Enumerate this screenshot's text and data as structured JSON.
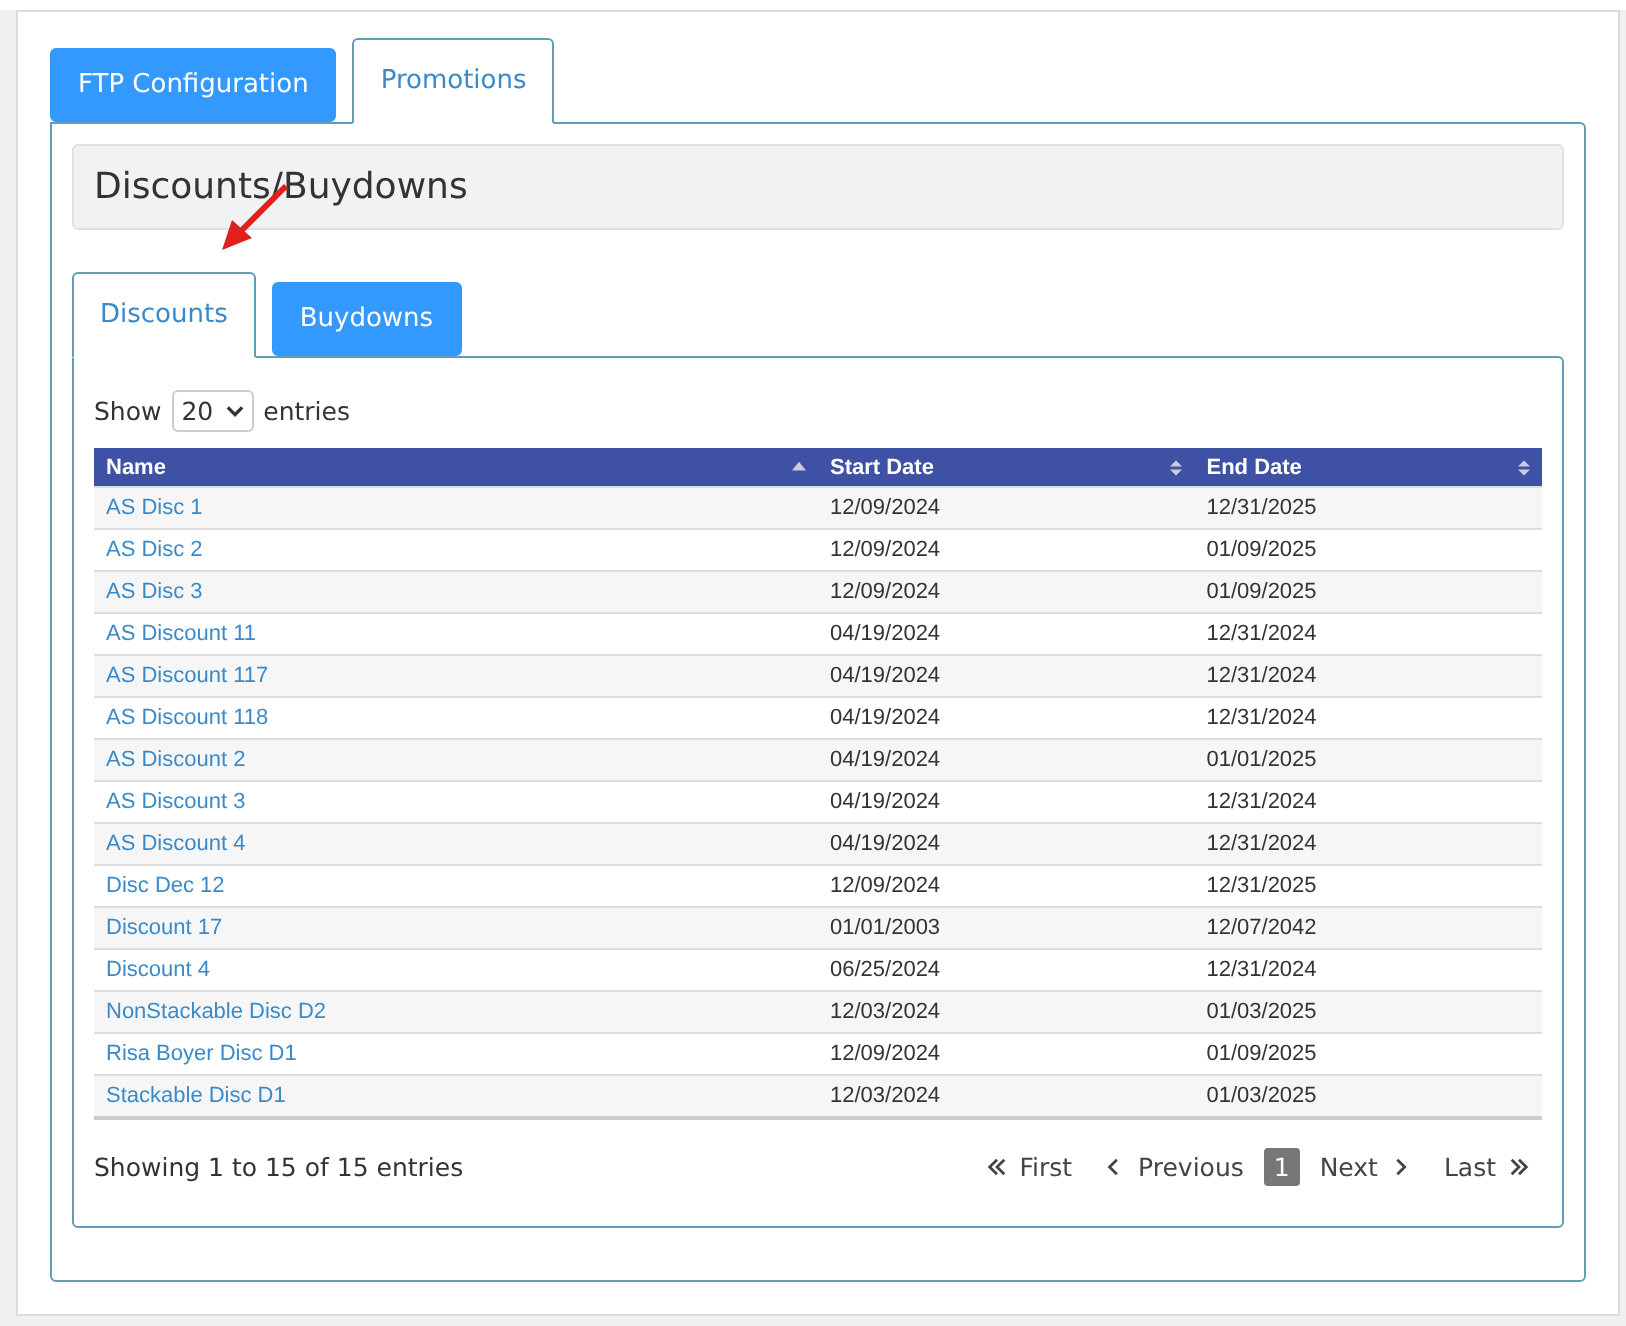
{
  "tabs": [
    {
      "label": "FTP Configuration",
      "selected": false
    },
    {
      "label": "Promotions",
      "selected": true
    }
  ],
  "section_title": "Discounts/Buydowns",
  "subtabs": [
    {
      "label": "Discounts",
      "selected": true
    },
    {
      "label": "Buydowns",
      "selected": false
    }
  ],
  "length_menu": {
    "before": "Show",
    "value": "20",
    "after": "entries"
  },
  "table": {
    "columns": [
      {
        "label": "Name",
        "sorted": true
      },
      {
        "label": "Start Date",
        "sorted": false
      },
      {
        "label": "End Date",
        "sorted": false
      }
    ],
    "rows": [
      [
        "AS Disc 1",
        "12/09/2024",
        "12/31/2025"
      ],
      [
        "AS Disc 2",
        "12/09/2024",
        "01/09/2025"
      ],
      [
        "AS Disc 3",
        "12/09/2024",
        "01/09/2025"
      ],
      [
        "AS Discount 11",
        "04/19/2024",
        "12/31/2024"
      ],
      [
        "AS Discount 117",
        "04/19/2024",
        "12/31/2024"
      ],
      [
        "AS Discount 118",
        "04/19/2024",
        "12/31/2024"
      ],
      [
        "AS Discount 2",
        "04/19/2024",
        "01/01/2025"
      ],
      [
        "AS Discount 3",
        "04/19/2024",
        "12/31/2024"
      ],
      [
        "AS Discount 4",
        "04/19/2024",
        "12/31/2024"
      ],
      [
        "Disc Dec 12",
        "12/09/2024",
        "12/31/2025"
      ],
      [
        "Discount 17",
        "01/01/2003",
        "12/07/2042"
      ],
      [
        "Discount  4",
        "06/25/2024",
        "12/31/2024"
      ],
      [
        "NonStackable Disc D2",
        "12/03/2024",
        "01/03/2025"
      ],
      [
        "Risa Boyer Disc D1",
        "12/09/2024",
        "01/09/2025"
      ],
      [
        "Stackable Disc D1",
        "12/03/2024",
        "01/03/2025"
      ]
    ]
  },
  "info": "Showing 1 to 15 of 15 entries",
  "pagination": [
    {
      "kind": "first",
      "label": "First",
      "selected": false
    },
    {
      "kind": "previous",
      "label": "Previous",
      "selected": false
    },
    {
      "kind": "page",
      "label": "1",
      "selected": true
    },
    {
      "kind": "next",
      "label": "Next",
      "selected": false
    },
    {
      "kind": "last",
      "label": "Last",
      "selected": false
    }
  ]
}
